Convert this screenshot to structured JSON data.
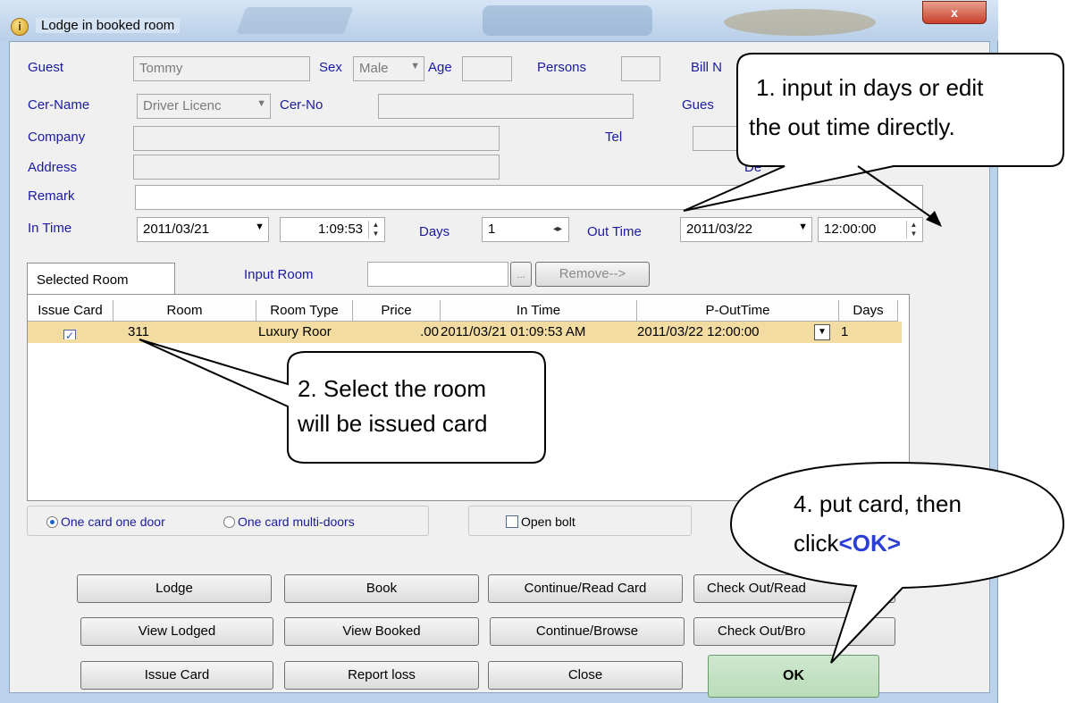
{
  "window": {
    "title": "Lodge in booked room",
    "close_label": "x"
  },
  "guest": {
    "guest_label": "Guest",
    "guest_value": "Tommy",
    "sex_label": "Sex",
    "sex_value": "Male",
    "age_label": "Age",
    "age_value": "",
    "persons_label": "Persons",
    "persons_value": "",
    "bill_label": "Bill N",
    "cer_name_label": "Cer-Name",
    "cer_name_value": "Driver Licenc",
    "cer_no_label": "Cer-No",
    "cer_no_value": "",
    "guest2_label": "Gues",
    "company_label": "Company",
    "company_value": "",
    "tel_label": "Tel",
    "tel_value": "",
    "address_label": "Address",
    "address_value": "",
    "dep_label": "De",
    "remark_label": "Remark",
    "remark_value": ""
  },
  "times": {
    "in_time_label": "In Time",
    "in_date": "2011/03/21",
    "in_clock": "1:09:53",
    "days_label": "Days",
    "days_value": "1",
    "out_time_label": "Out Time",
    "out_date": "2011/03/22",
    "out_clock": "12:00:00"
  },
  "room_tabs": {
    "selected_tab": "Selected Room",
    "input_room_label": "Input Room",
    "input_room_value": "",
    "browse_label": "...",
    "remove_label": "Remove-->"
  },
  "room_list": {
    "columns": [
      "Issue Card",
      "Room",
      "Room Type",
      "Price",
      "In Time",
      "P-OutTime",
      "Days"
    ],
    "rows": [
      {
        "issue_card": true,
        "room": "311",
        "room_type": "Luxury Roor",
        "price": ".00",
        "in_time": "2011/03/21 01:09:53 AM",
        "p_out_time": "2011/03/22 12:00:00",
        "days": "1"
      }
    ]
  },
  "options": {
    "one_card_one_door": "One card one door",
    "one_card_multi_doors": "One card multi-doors",
    "open_bolt": "Open bolt"
  },
  "buttons": {
    "lodge": "Lodge",
    "book": "Book",
    "continue_read": "Continue/Read Card",
    "checkout_read": "Check Out/Read",
    "view_lodged": "View Lodged",
    "view_booked": "View Booked",
    "continue_browse": "Continue/Browse",
    "checkout_browse": "Check Out/Bro",
    "issue_card": "Issue Card",
    "report_loss": "Report loss",
    "close": "Close",
    "ok": "OK"
  },
  "callouts": {
    "c1_line1": "1. input in days or edit",
    "c1_line2": "the out time directly.",
    "c2_line1": "2. Select the room",
    "c2_line2": "will be issued card",
    "c4_line1": "4. put card, then",
    "c4_line2": "click",
    "c4_ok": "<OK>"
  }
}
